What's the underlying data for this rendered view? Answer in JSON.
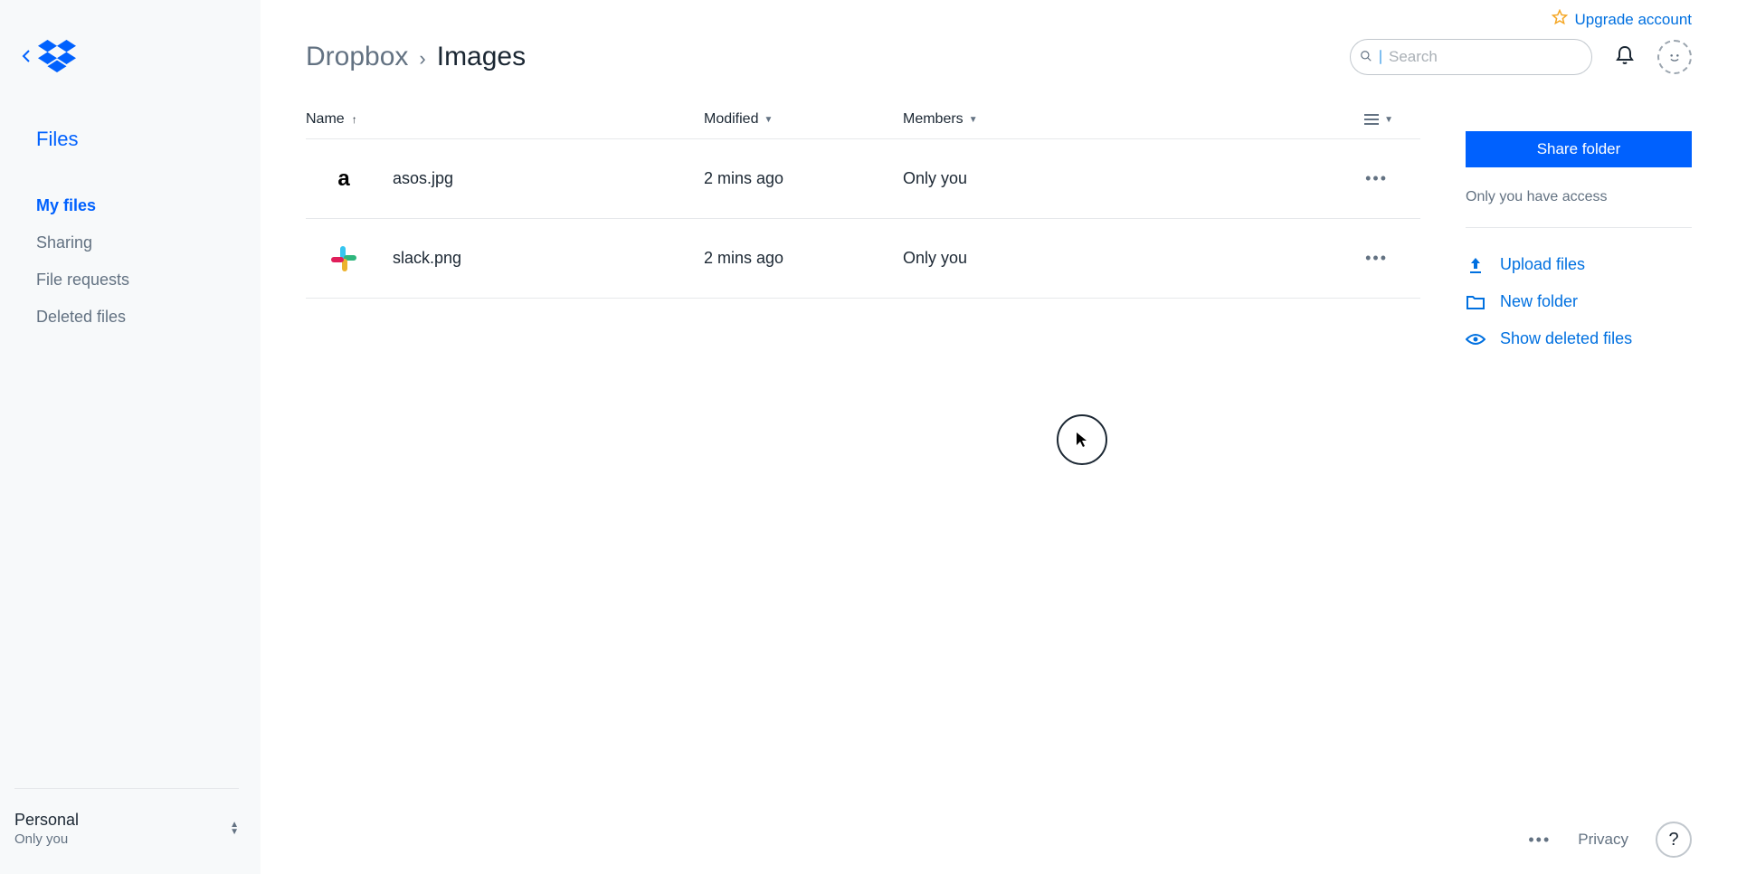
{
  "sidebar": {
    "nav_heading": "Files",
    "items": [
      {
        "label": "My files",
        "active": true
      },
      {
        "label": "Sharing",
        "active": false
      },
      {
        "label": "File requests",
        "active": false
      },
      {
        "label": "Deleted files",
        "active": false
      }
    ],
    "account": {
      "name": "Personal",
      "sub": "Only you"
    }
  },
  "header": {
    "upgrade_label": "Upgrade account",
    "breadcrumb_root": "Dropbox",
    "breadcrumb_current": "Images",
    "search_placeholder": "Search"
  },
  "table": {
    "columns": {
      "name": "Name",
      "modified": "Modified",
      "members": "Members"
    },
    "rows": [
      {
        "icon": "asos",
        "name": "asos.jpg",
        "modified": "2 mins ago",
        "members": "Only you"
      },
      {
        "icon": "slack",
        "name": "slack.png",
        "modified": "2 mins ago",
        "members": "Only you"
      }
    ]
  },
  "sidepanel": {
    "share_label": "Share folder",
    "access_text": "Only you have access",
    "actions": {
      "upload": "Upload files",
      "new_folder": "New folder",
      "show_deleted": "Show deleted files"
    }
  },
  "footer": {
    "privacy": "Privacy",
    "help": "?"
  }
}
